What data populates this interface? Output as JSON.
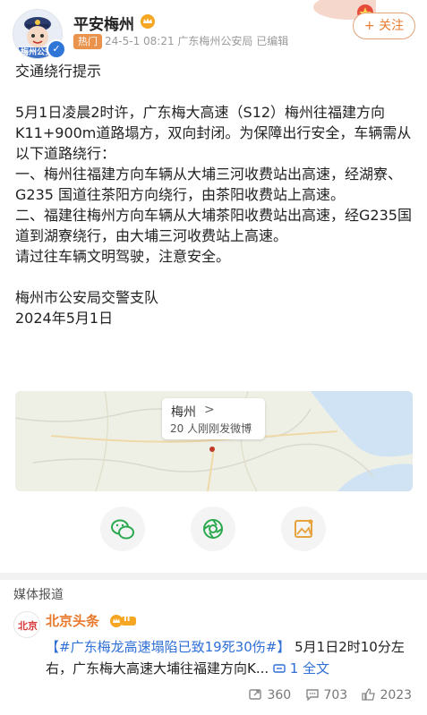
{
  "account": {
    "name": "平安梅州",
    "hot_tag": "热门",
    "meta": "24-5-1 08:21  广东梅州公安局 已编辑",
    "avatar_text": "梅州公安",
    "follow_label": "+ 关注"
  },
  "post": {
    "title": "交通绕行提示",
    "paragraph1": "5月1日凌晨2时许，广东梅大高速（S12）梅州往福建方向K11+900m道路塌方，双向封闭。为保障出行安全，车辆需从以下道路绕行：",
    "item1": "一、梅州往福建方向车辆从大埔三河收费站出高速，经湖寮、G235 国道往茶阳方向绕行，由茶阳收费站上高速。",
    "item2": "二、福建往梅州方向车辆从大埔茶阳收费站出高速，经G235国道到湖寮绕行，由大埔三河收费站上高速。",
    "closing": "请过往车辆文明驾驶，注意安全。",
    "signature": "梅州市公安局交警支队",
    "date": "2024年5月1日"
  },
  "map": {
    "city": "梅州",
    "chevron": ">",
    "subtitle": "20 人刚刚发微博"
  },
  "share": {
    "icons": [
      "wechat-icon",
      "moments-icon",
      "image-share-icon"
    ]
  },
  "media": {
    "section_title": "媒体报道",
    "source_name": "北京头条",
    "badge_text": "II",
    "hashtag": "#广东梅龙高速塌陷已致19死30伤#",
    "text": "5月1日2时10分左右，广东梅大高速大埔往福建方向K...",
    "link_icon": "link-icon",
    "link_count": "1",
    "full_text": "全文",
    "reposts": "360",
    "comments": "703",
    "likes": "2023"
  },
  "colors": {
    "accent_orange": "#e97b2f",
    "link_blue": "#2f6fd6",
    "hot_tag": "#e9934d"
  }
}
